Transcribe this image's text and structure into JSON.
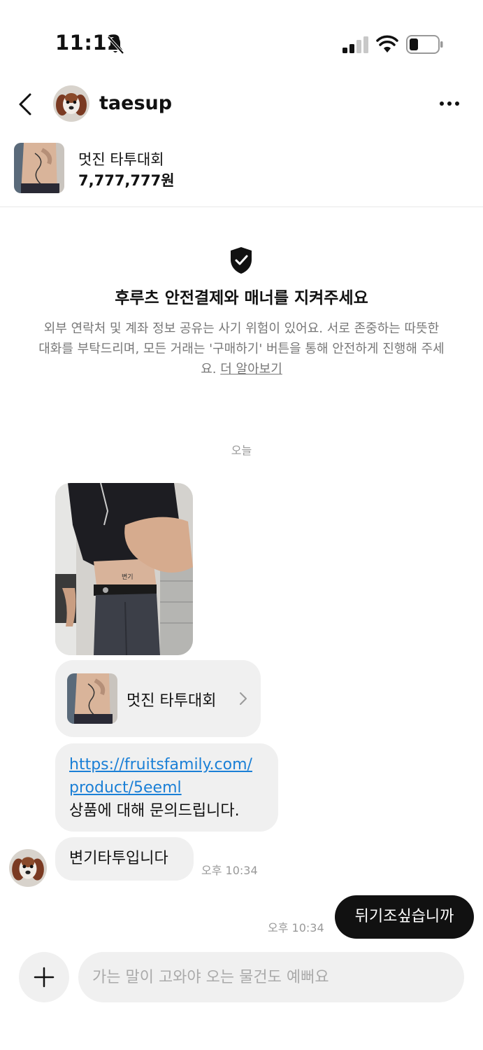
{
  "status_bar": {
    "time": "11:12"
  },
  "header": {
    "username": "taesup"
  },
  "product": {
    "name": "멋진 타투대회",
    "price": "7,777,777원"
  },
  "notice": {
    "title": "후루츠 안전결제와 매너를 지켜주세요",
    "body": "외부 연락처 및 계좌 정보 공유는 사기 위험이 있어요. 서로 존중하는 따뜻한 대화를 부탁드리며, 모든 거래는 '구매하기' 버튼을 통해 안전하게 진행해 주세요. ",
    "link": "더 알아보기"
  },
  "date_separator": "오늘",
  "messages": {
    "product_card_label": "멋진 타투대회",
    "link_url_line1": "https://fruitsfamily.com/",
    "link_url_line2": "product/5eeml",
    "link_message": "상품에 대해 문의드립니다.",
    "incoming_text": "변기타투입니다",
    "incoming_time": "오후 10:34",
    "outgoing_time": "오후 10:34",
    "outgoing_text": "뒤기조싶습니까"
  },
  "input": {
    "placeholder": "가는 말이 고와야 오는 물건도 예뻐요"
  }
}
